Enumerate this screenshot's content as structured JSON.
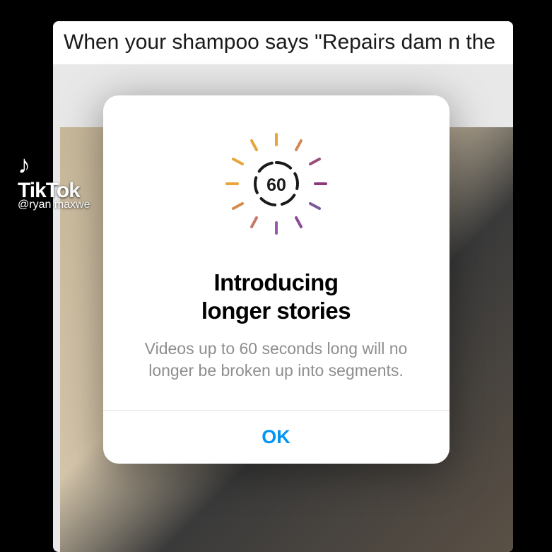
{
  "background": {
    "caption_text": "When your shampoo says \"Repairs dam                                           n the",
    "watermark": {
      "brand": "TikTok",
      "username": "@ryan maxwe"
    }
  },
  "modal": {
    "icon_number": "60",
    "title_line1": "Introducing",
    "title_line2": "longer stories",
    "description": "Videos up to 60 seconds long will no longer be broken up into segments.",
    "ok_label": "OK"
  }
}
